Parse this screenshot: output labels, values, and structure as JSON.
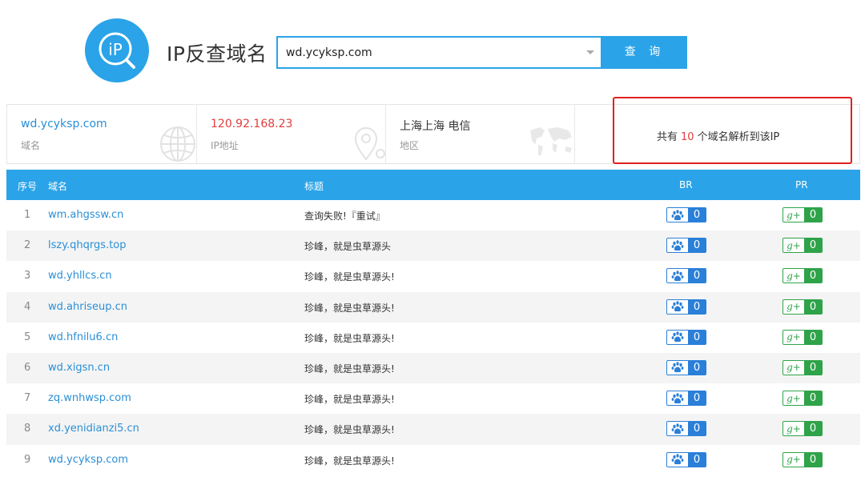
{
  "header": {
    "logo_text": "iP",
    "title": "IP反查域名",
    "search_value": "wd.ycyksp.com",
    "search_button": "查 询"
  },
  "info": {
    "domain": {
      "value": "wd.ycyksp.com",
      "label": "域名"
    },
    "ip": {
      "value": "120.92.168.23",
      "label": "IP地址"
    },
    "region": {
      "value": "上海上海 电信",
      "label": "地区"
    },
    "count": {
      "prefix": "共有",
      "number": "10",
      "suffix": "个域名解析到该IP"
    }
  },
  "table": {
    "headers": {
      "index": "序号",
      "domain": "域名",
      "title": "标题",
      "br": "BR",
      "pr": "PR"
    },
    "rows": [
      {
        "index": "1",
        "domain": "wm.ahgssw.cn",
        "title": "查询失败!『重试』",
        "br": "0",
        "pr": "0"
      },
      {
        "index": "2",
        "domain": "lszy.qhqrgs.top",
        "title": "珍峰，就是虫草源头",
        "br": "0",
        "pr": "0"
      },
      {
        "index": "3",
        "domain": "wd.yhllcs.cn",
        "title": "珍峰，就是虫草源头!",
        "br": "0",
        "pr": "0"
      },
      {
        "index": "4",
        "domain": "wd.ahriseup.cn",
        "title": "珍峰，就是虫草源头!",
        "br": "0",
        "pr": "0"
      },
      {
        "index": "5",
        "domain": "wd.hfnilu6.cn",
        "title": "珍峰，就是虫草源头!",
        "br": "0",
        "pr": "0"
      },
      {
        "index": "6",
        "domain": "wd.xigsn.cn",
        "title": "珍峰，就是虫草源头!",
        "br": "0",
        "pr": "0"
      },
      {
        "index": "7",
        "domain": "zq.wnhwsp.com",
        "title": "珍峰，就是虫草源头!",
        "br": "0",
        "pr": "0"
      },
      {
        "index": "8",
        "domain": "xd.yenidianzi5.cn",
        "title": "珍峰，就是虫草源头!",
        "br": "0",
        "pr": "0"
      },
      {
        "index": "9",
        "domain": "wd.ycyksp.com",
        "title": "珍峰，就是虫草源头!",
        "br": "0",
        "pr": "0"
      }
    ]
  },
  "icons": {
    "logo": "ip-magnifier-icon",
    "br": "baidu-paw-icon",
    "pr": "google-plus-icon",
    "pr_glyph": "g+"
  },
  "colors": {
    "accent": "#2aa3e8",
    "ip_text": "#e23c3c",
    "highlight": "#e02020",
    "br_badge": "#2a7fd8",
    "pr_badge": "#2ea349"
  }
}
